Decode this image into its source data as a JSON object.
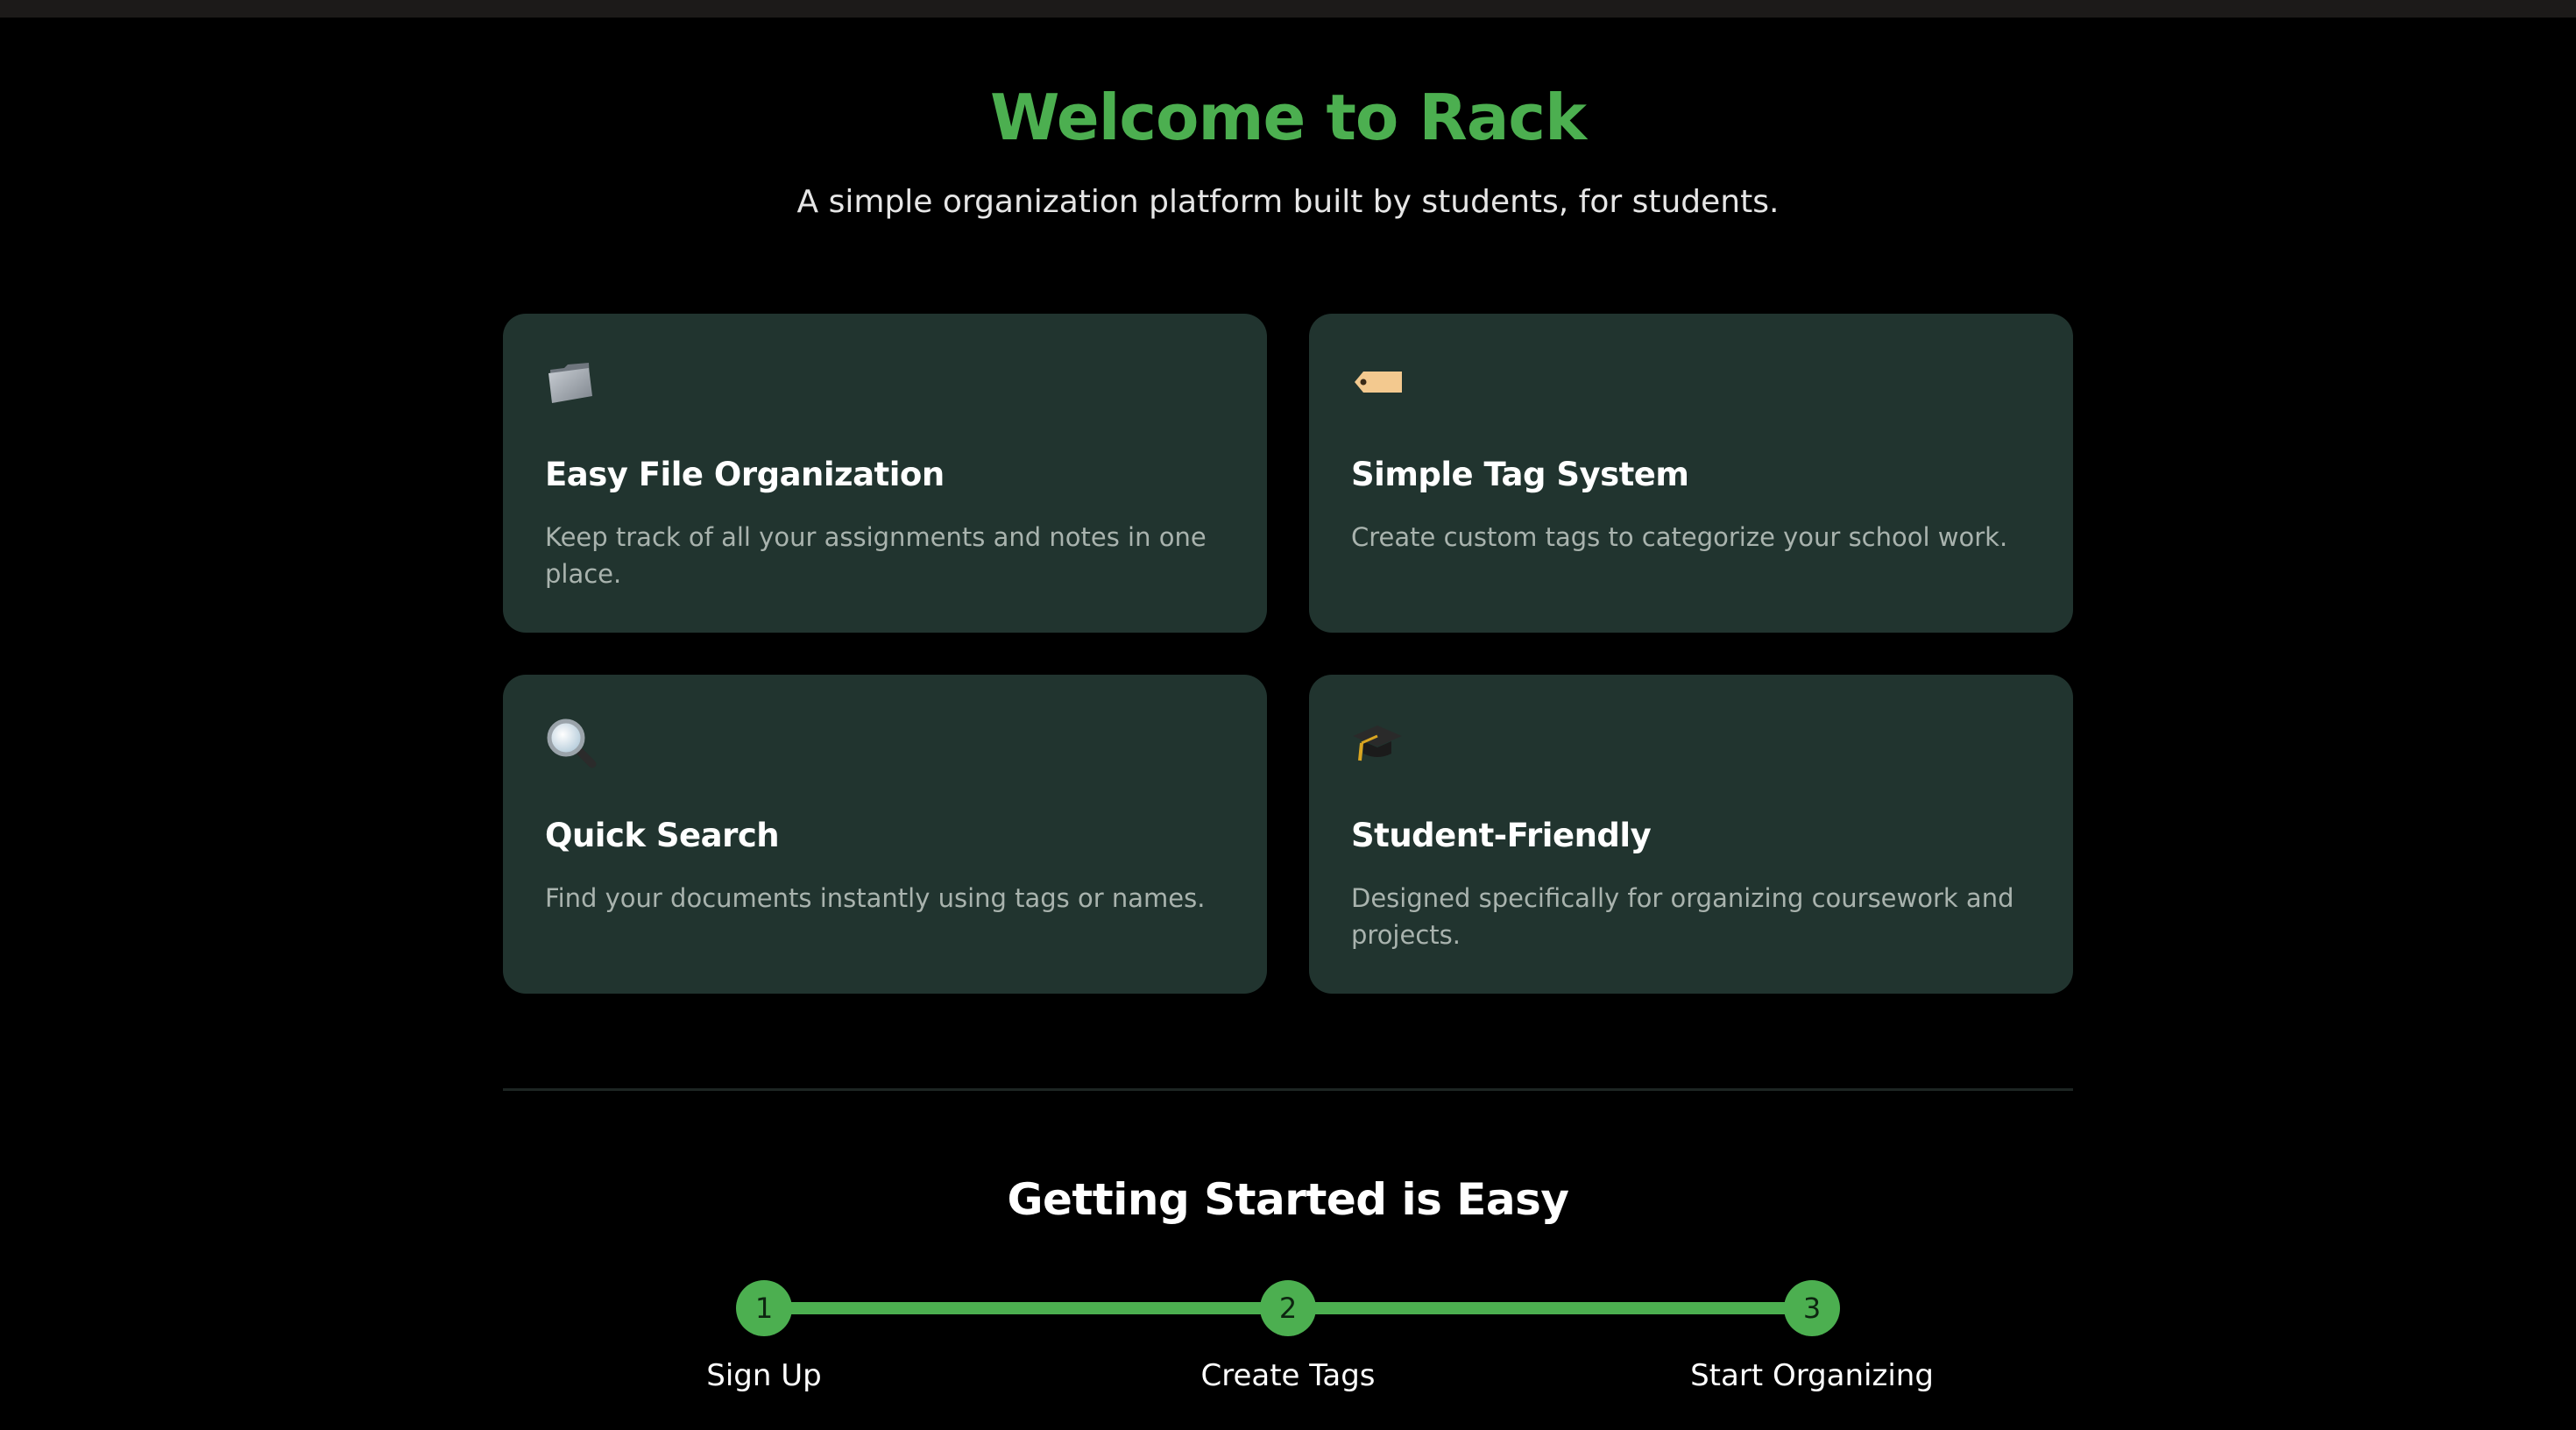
{
  "hero": {
    "title": "Welcome to Rack",
    "subtitle": "A simple organization platform built by students, for students."
  },
  "features": [
    {
      "icon": "folder-icon",
      "title": "Easy File Organization",
      "description": "Keep track of all your assignments and notes in one place."
    },
    {
      "icon": "tag-icon",
      "title": "Simple Tag System",
      "description": "Create custom tags to categorize your school work."
    },
    {
      "icon": "magnifier-icon",
      "title": "Quick Search",
      "description": "Find your documents instantly using tags or names."
    },
    {
      "icon": "graduation-cap-icon",
      "title": "Student-Friendly",
      "description": "Designed specifically for organizing coursework and projects."
    }
  ],
  "getting_started": {
    "title": "Getting Started is Easy",
    "steps": [
      {
        "number": "1",
        "label": "Sign Up"
      },
      {
        "number": "2",
        "label": "Create Tags"
      },
      {
        "number": "3",
        "label": "Start Organizing"
      }
    ]
  },
  "colors": {
    "accent": "#4caf50",
    "card_bg": "#21342f",
    "page_bg": "#000000"
  }
}
